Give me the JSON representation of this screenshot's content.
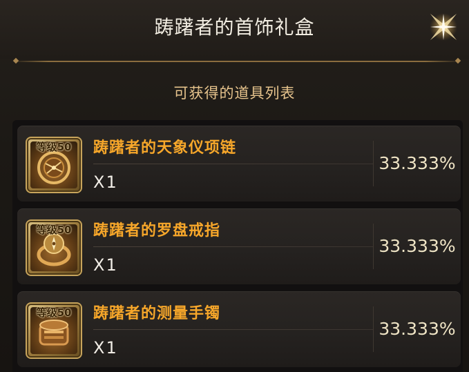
{
  "header": {
    "title": "踌躇者的首饰礼盒"
  },
  "subtitle": "可获得的道具列表",
  "items": [
    {
      "level_badge": "等级50",
      "name": "踌躇者的天象仪项链",
      "quantity": "X1",
      "probability": "33.333%",
      "icon": "amulet-icon"
    },
    {
      "level_badge": "等级50",
      "name": "踌躇者的罗盘戒指",
      "quantity": "X1",
      "probability": "33.333%",
      "icon": "ring-icon"
    },
    {
      "level_badge": "等级50",
      "name": "踌躇者的测量手镯",
      "quantity": "X1",
      "probability": "33.333%",
      "icon": "bracelet-icon"
    }
  ],
  "colors": {
    "item_name": "#f7a72a",
    "subtitle": "#e7c48d",
    "title": "#f2ede2",
    "icon_border": "#c8a55c"
  }
}
